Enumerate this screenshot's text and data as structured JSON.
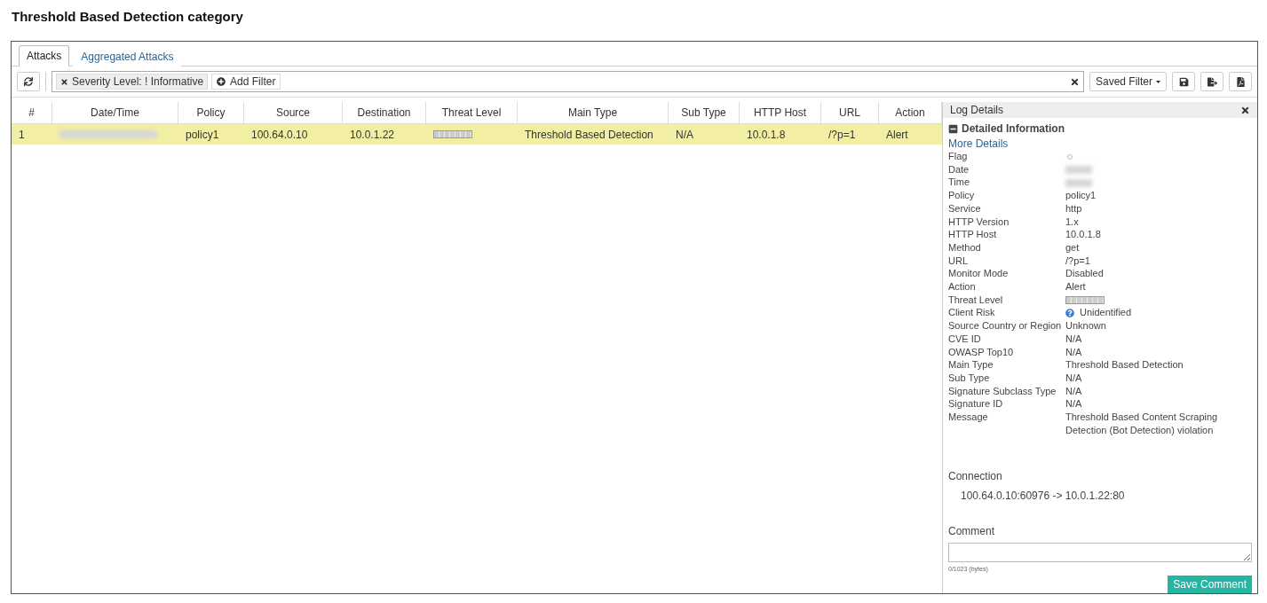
{
  "page_title": "Threshold Based Detection category",
  "tabs": [
    {
      "label": "Attacks",
      "selected": true
    },
    {
      "label": "Aggregated Attacks",
      "selected": false
    }
  ],
  "filter_bar": {
    "filters": [
      {
        "label": "Severity Level: ! Informative"
      }
    ],
    "add_filter": "Add Filter",
    "saved_filter": "Saved Filter"
  },
  "table": {
    "columns": [
      "#",
      "Date/Time",
      "Policy",
      "Source",
      "Destination",
      "Threat Level",
      "Main Type",
      "Sub Type",
      "HTTP Host",
      "URL",
      "Action"
    ],
    "rows": [
      {
        "selected": true,
        "cells": [
          {
            "kind": "text",
            "value": "1"
          },
          {
            "kind": "blurred"
          },
          {
            "kind": "text",
            "value": "policy1"
          },
          {
            "kind": "text",
            "value": "100.64.0.10"
          },
          {
            "kind": "text",
            "value": "10.0.1.22"
          },
          {
            "kind": "bar"
          },
          {
            "kind": "text",
            "value": "Threshold Based Detection"
          },
          {
            "kind": "text",
            "value": "N/A"
          },
          {
            "kind": "text",
            "value": "10.0.1.8"
          },
          {
            "kind": "text",
            "value": "/?p=1"
          },
          {
            "kind": "text",
            "value": "Alert"
          }
        ]
      }
    ]
  },
  "log_details": {
    "title": "Log Details",
    "section": "Detailed Information",
    "expanded": true,
    "more_details": "More Details",
    "fields": [
      {
        "label": "Flag",
        "kind": "flag"
      },
      {
        "label": "Date",
        "kind": "blurred"
      },
      {
        "label": "Time",
        "kind": "blurred"
      },
      {
        "label": "Policy",
        "kind": "text",
        "value": "policy1"
      },
      {
        "label": "Service",
        "kind": "text",
        "value": "http"
      },
      {
        "label": "HTTP Version",
        "kind": "text",
        "value": "1.x"
      },
      {
        "label": "HTTP Host",
        "kind": "text",
        "value": "10.0.1.8"
      },
      {
        "label": "Method",
        "kind": "text",
        "value": "get"
      },
      {
        "label": "URL",
        "kind": "text",
        "value": "/?p=1"
      },
      {
        "label": "Monitor Mode",
        "kind": "text",
        "value": "Disabled"
      },
      {
        "label": "Action",
        "kind": "text",
        "value": "Alert"
      },
      {
        "label": "Threat Level",
        "kind": "bar"
      },
      {
        "label": "Client Risk",
        "kind": "risk",
        "value": "Unidentified"
      },
      {
        "label": "Source Country or Region",
        "kind": "text",
        "value": "Unknown"
      },
      {
        "label": "CVE ID",
        "kind": "text",
        "value": "N/A"
      },
      {
        "label": "OWASP Top10",
        "kind": "text",
        "value": "N/A"
      },
      {
        "label": "Main Type",
        "kind": "text",
        "value": "Threshold Based Detection"
      },
      {
        "label": "Sub Type",
        "kind": "text",
        "value": "N/A"
      },
      {
        "label": "Signature Subclass Type",
        "kind": "text",
        "value": "N/A"
      },
      {
        "label": "Signature ID",
        "kind": "text",
        "value": "N/A"
      },
      {
        "label": "Message",
        "kind": "text",
        "value": "Threshold Based Content Scraping Detection (Bot Detection) violation"
      }
    ],
    "connection_label": "Connection",
    "connection": "100.64.0.10:60976 -> 10.0.1.22:80",
    "comment_label": "Comment",
    "comment_counter": "0/1023 (bytes)",
    "save_comment": "Save Comment"
  }
}
